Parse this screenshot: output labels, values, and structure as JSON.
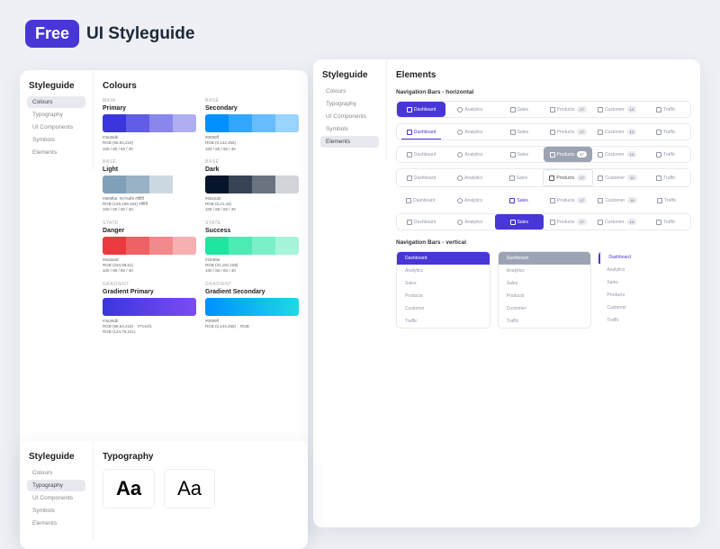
{
  "header": {
    "badge": "Free",
    "title": "UI Styleguide"
  },
  "sidebar": {
    "title": "Styleguide",
    "items": [
      "Colours",
      "Typography",
      "UI Components",
      "Symbols",
      "Elements"
    ]
  },
  "colours": {
    "title": "Colours",
    "groups": [
      {
        "lbl": "MAIN",
        "name": "Primary",
        "hex": "#3a36db",
        "rgb": "RGB (58,54,219)",
        "p": "100 / 80 / 60 / 40",
        "cols": [
          "#3a36db",
          "#615de4",
          "#8986ec",
          "#b0aef3"
        ]
      },
      {
        "lbl": "BASE",
        "name": "Secondary",
        "hex": "#0090ff",
        "rgb": "RGB (0,144,255)",
        "p": "100 / 80 / 60 / 40",
        "cols": [
          "#0090ff",
          "#33a6ff",
          "#66bcff",
          "#99d3ff"
        ]
      },
      {
        "lbl": "BASE",
        "name": "Light",
        "hex": "#809fb8",
        "extra": "#e7edf5   #ffffff",
        "rgb": "RGB (128,159,184)  #ffffff",
        "p": "100 / 80 / 60 / 40",
        "cols": [
          "#809fb8",
          "#99b2c6",
          "#ccd9e3",
          "#ffffff"
        ]
      },
      {
        "lbl": "BASE",
        "name": "Dark",
        "hex": "#06152b",
        "rgb": "RGB (6,21,43)",
        "p": "100 / 80 / 60 / 40",
        "cols": [
          "#06152b",
          "#384455",
          "#6a7380",
          "#d1d4d9"
        ]
      },
      {
        "lbl": "STATE",
        "name": "Danger",
        "hex": "#ea3a3d",
        "rgb": "RGB (234,58,61)",
        "p": "100 / 80 / 60 / 40",
        "cols": [
          "#ea3a3d",
          "#ee6164",
          "#f2898b",
          "#f7b0b1"
        ]
      },
      {
        "lbl": "STATE",
        "name": "Success",
        "hex": "#1fe59e",
        "rgb": "RGB (31,181,158)",
        "p": "100 / 80 / 60 / 40",
        "cols": [
          "#1fe59e",
          "#4cebb3",
          "#79f0c7",
          "#a5f5db"
        ]
      },
      {
        "lbl": "GRADIENT",
        "name": "Gradient Primary",
        "hex": "#3a36db",
        "rgb": "RGB (58,54,219)",
        "hex2": "#7c4cf1",
        "rgb2": "RGB (124,78,241)",
        "grad": [
          "#3a36db",
          "#7c4cf1"
        ]
      },
      {
        "lbl": "GRADIENT",
        "name": "Gradient Secondary",
        "hex": "#0090ff",
        "rgb": "RGB (0,144,255)",
        "hex2": "RGB",
        "grad": [
          "#0090ff",
          "#1fd9e5"
        ]
      }
    ]
  },
  "typography": {
    "title": "Typography",
    "sample": "Aa"
  },
  "elements": {
    "title": "Elements",
    "sub1": "Navigation Bars - horizontal",
    "sub2": "Navigation Bars - vertical",
    "items": [
      {
        "label": "Dashboard",
        "badge": "",
        "icon": "sq"
      },
      {
        "label": "Analytics",
        "badge": "",
        "icon": "circ"
      },
      {
        "label": "Sales",
        "badge": "",
        "icon": "sq"
      },
      {
        "label": "Products",
        "badge": "17",
        "icon": "sq"
      },
      {
        "label": "Customer",
        "badge": "14",
        "icon": "sq"
      },
      {
        "label": "Traffic",
        "badge": "",
        "icon": "sq"
      }
    ]
  }
}
